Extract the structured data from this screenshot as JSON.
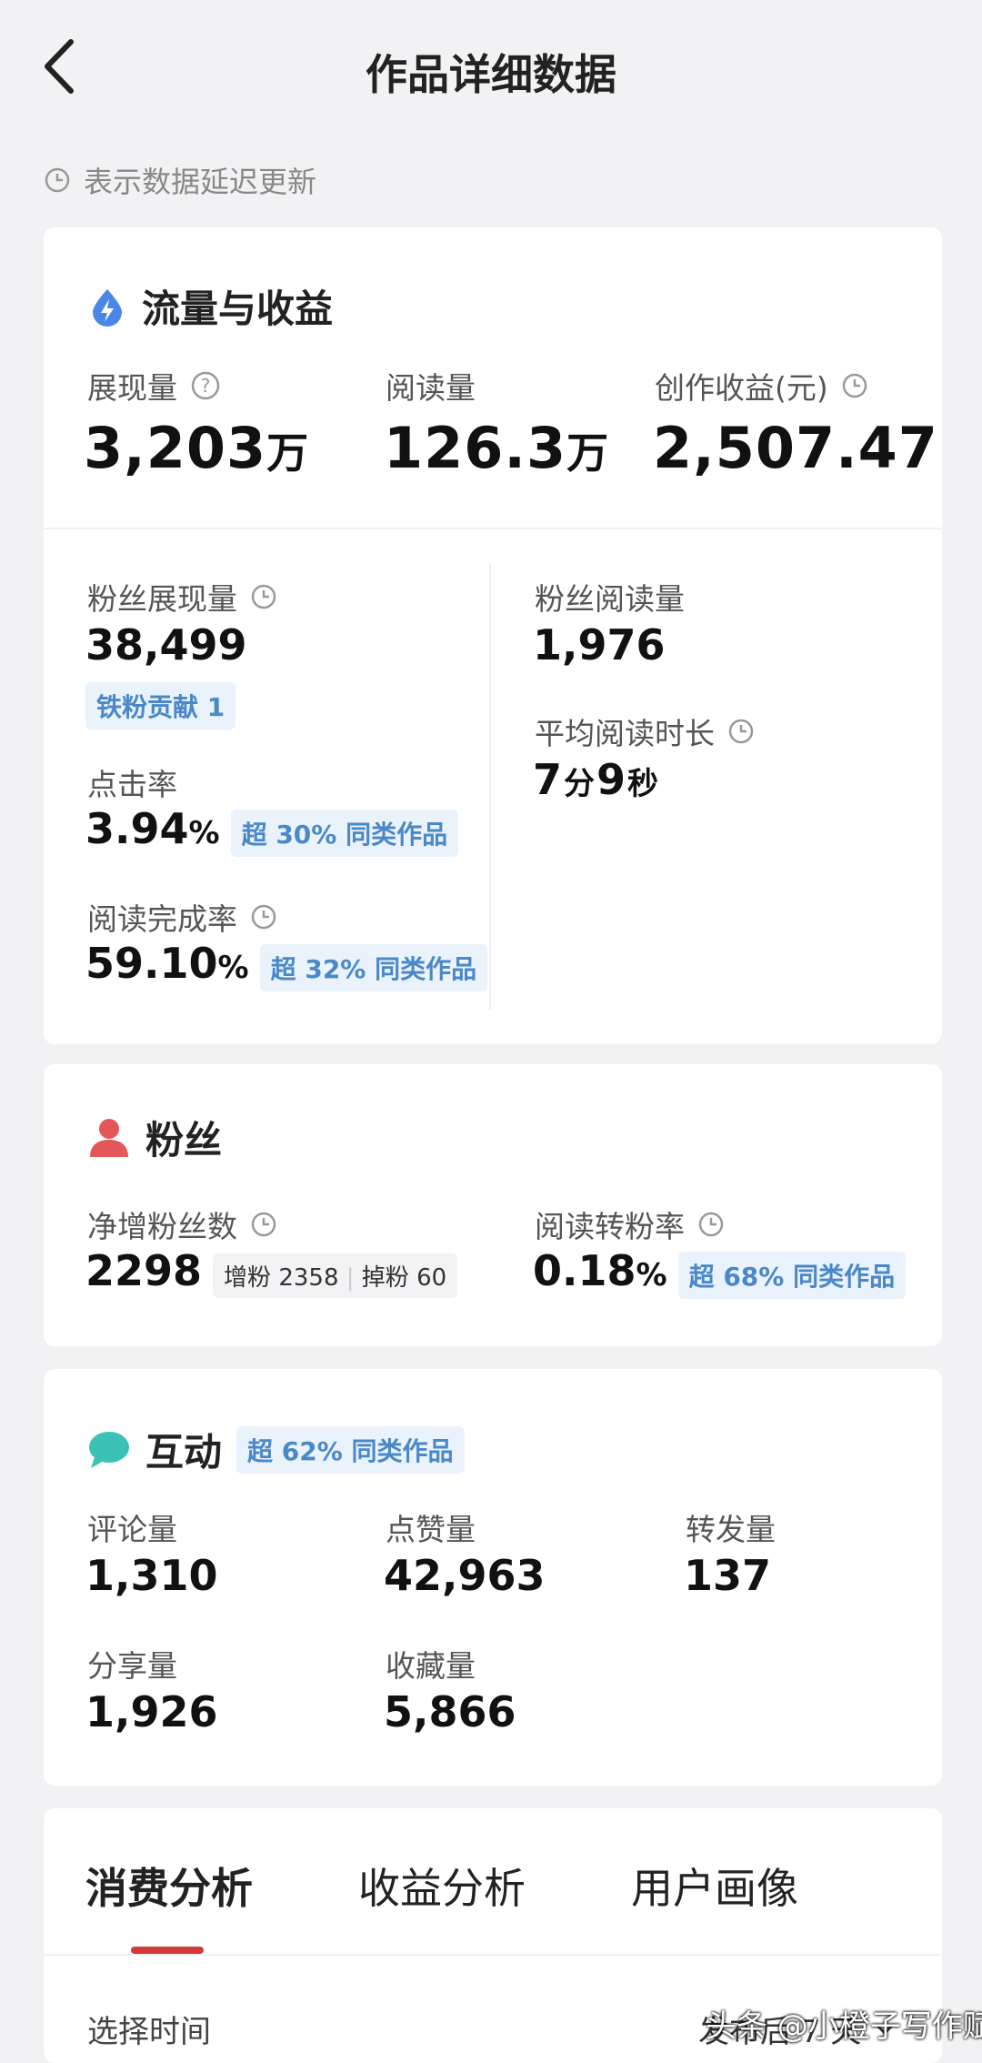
{
  "header": {
    "title": "作品详细数据"
  },
  "notice": "表示数据延迟更新",
  "traffic": {
    "title": "流量与收益",
    "impressions": {
      "label": "展现量",
      "value": "3,203",
      "unit": "万"
    },
    "reads": {
      "label": "阅读量",
      "value": "126.3",
      "unit": "万"
    },
    "income": {
      "label": "创作收益(元)",
      "value": "2,507.47"
    },
    "fan_impressions": {
      "label": "粉丝展现量",
      "value": "38,499",
      "chip": "铁粉贡献 1"
    },
    "fan_reads": {
      "label": "粉丝阅读量",
      "value": "1,976"
    },
    "avg_read_time": {
      "label": "平均阅读时长",
      "min": "7",
      "min_unit": "分",
      "sec": "9",
      "sec_unit": "秒"
    },
    "ctr": {
      "label": "点击率",
      "value": "3.94",
      "unit": "%",
      "chip": "超 30% 同类作品"
    },
    "completion": {
      "label": "阅读完成率",
      "value": "59.10",
      "unit": "%",
      "chip": "超 32% 同类作品"
    }
  },
  "fans": {
    "title": "粉丝",
    "net": {
      "label": "净增粉丝数",
      "value": "2298",
      "gain_label": "增粉",
      "gain": "2358",
      "loss_label": "掉粉",
      "loss": "60"
    },
    "conversion": {
      "label": "阅读转粉率",
      "value": "0.18",
      "unit": "%",
      "chip": "超 68% 同类作品"
    }
  },
  "interaction": {
    "title": "互动",
    "chip": "超 62% 同类作品",
    "comments": {
      "label": "评论量",
      "value": "1,310"
    },
    "likes": {
      "label": "点赞量",
      "value": "42,963"
    },
    "forwards": {
      "label": "转发量",
      "value": "137"
    },
    "shares": {
      "label": "分享量",
      "value": "1,926"
    },
    "favorites": {
      "label": "收藏量",
      "value": "5,866"
    }
  },
  "tabs": [
    "消费分析",
    "收益分析",
    "用户画像"
  ],
  "select_time_label": "选择时间",
  "time_range": "发布后 7 天",
  "watermark": "头条 @小橙子写作赋能",
  "colors": {
    "accent_red": "#d23a3a",
    "chip_blue": "#4a88c9",
    "background": "#f2f2f4"
  }
}
